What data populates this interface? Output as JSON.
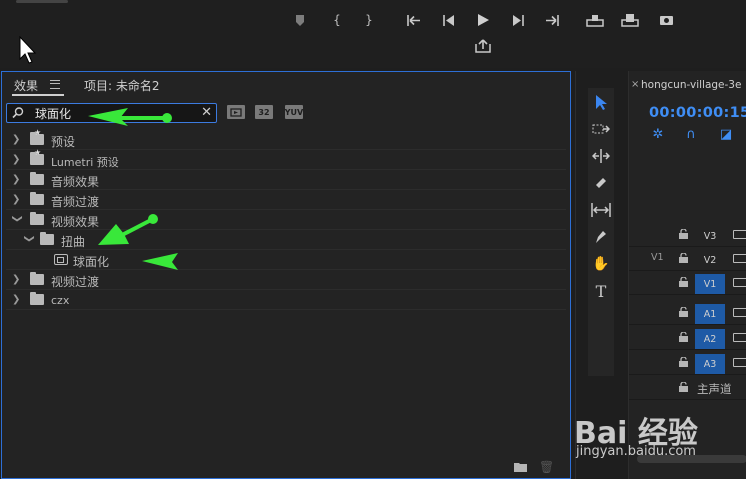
{
  "effects_panel": {
    "tab_effects": "效果",
    "tab_project": "项目: 未命名2",
    "search": {
      "value": "球面化",
      "placeholder": ""
    },
    "badges": [
      "32",
      "YUV"
    ],
    "tree": [
      {
        "label": "预设",
        "depth": 0,
        "expanded": false,
        "icon": "preset-folder-icon"
      },
      {
        "label": "Lumetri 预设",
        "depth": 0,
        "expanded": false,
        "icon": "preset-folder-icon"
      },
      {
        "label": "音频效果",
        "depth": 0,
        "expanded": false,
        "icon": "folder-icon"
      },
      {
        "label": "音频过渡",
        "depth": 0,
        "expanded": false,
        "icon": "folder-icon"
      },
      {
        "label": "视频效果",
        "depth": 0,
        "expanded": true,
        "icon": "folder-icon"
      },
      {
        "label": "扭曲",
        "depth": 1,
        "expanded": true,
        "icon": "folder-icon"
      },
      {
        "label": "球面化",
        "depth": 2,
        "expanded": false,
        "icon": "effect-icon"
      },
      {
        "label": "视频过渡",
        "depth": 0,
        "expanded": false,
        "icon": "folder-icon"
      },
      {
        "label": "czx",
        "depth": 0,
        "expanded": false,
        "icon": "folder-icon"
      }
    ]
  },
  "timeline": {
    "sequence_tab": "hongcun-village-3e",
    "timecode": "00:00:00:15",
    "tracks": [
      {
        "source": "",
        "name": "V3",
        "targeted": false
      },
      {
        "source": "V1",
        "name": "V2",
        "targeted": false
      },
      {
        "source": "",
        "name": "V1",
        "targeted": true
      },
      {
        "source": "",
        "name": "A1",
        "targeted": true
      },
      {
        "source": "",
        "name": "A2",
        "targeted": true
      },
      {
        "source": "",
        "name": "A3",
        "targeted": true
      }
    ],
    "master": "主声道"
  },
  "watermark": {
    "brand": "Bai 经验",
    "url": "jingyan.baidu.com"
  },
  "colors": {
    "accent": "#3f8ef5",
    "panel_border": "#2d6fd6",
    "arrow": "#39e83a",
    "track_on": "#1e5aa6"
  }
}
